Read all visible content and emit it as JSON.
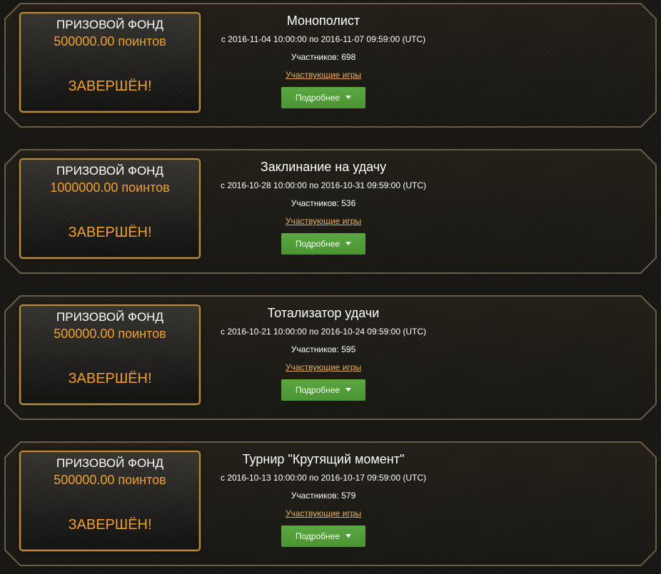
{
  "tournaments": [
    {
      "prize_title": "ПРИЗОВОЙ ФОНД",
      "prize_amount": "500000.00 поинтов",
      "status": "ЗАВЕРШЁН!",
      "name": "Монополист",
      "dates": "с 2016-11-04 10:00:00 по 2016-11-07 09:59:00 (UTC)",
      "participants": "Участников: 698",
      "games_link": "Участвующие игры",
      "more_label": "Подробнее"
    },
    {
      "prize_title": "ПРИЗОВОЙ ФОНД",
      "prize_amount": "1000000.00 поинтов",
      "status": "ЗАВЕРШЁН!",
      "name": "Заклинание на удачу",
      "dates": "с 2016-10-28 10:00:00 по 2016-10-31 09:59:00 (UTC)",
      "participants": "Участников: 536",
      "games_link": "Участвующие игры",
      "more_label": "Подробнее"
    },
    {
      "prize_title": "ПРИЗОВОЙ ФОНД",
      "prize_amount": "500000.00 поинтов",
      "status": "ЗАВЕРШЁН!",
      "name": "Тотализатор удачи",
      "dates": "с 2016-10-21 10:00:00 по 2016-10-24 09:59:00 (UTC)",
      "participants": "Участников: 595",
      "games_link": "Участвующие игры",
      "more_label": "Подробнее"
    },
    {
      "prize_title": "ПРИЗОВОЙ ФОНД",
      "prize_amount": "500000.00 поинтов",
      "status": "ЗАВЕРШЁН!",
      "name": "Турнир \"Крутящий момент\"",
      "dates": "с 2016-10-13 10:00:00 по 2016-10-17 09:59:00 (UTC)",
      "participants": "Участников: 579",
      "games_link": "Участвующие игры",
      "more_label": "Подробнее"
    }
  ],
  "icons": {
    "more_button_icon": "caret-down-icon"
  },
  "colors": {
    "accent_orange": "#f0a030",
    "link_color": "#e7b064",
    "button_green": "#59a83f",
    "frame_gold": "#b88a3f"
  }
}
